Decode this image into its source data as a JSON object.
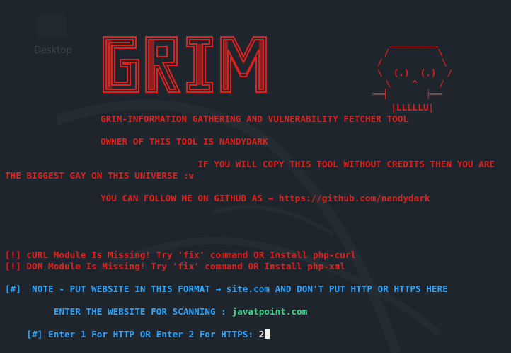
{
  "desktop": {
    "label": "Desktop"
  },
  "banner": {
    "logo_text": "GRIM",
    "skull": [
      " _________",
      " /         \\",
      "/           \\",
      "\\  (.)  (.)  /",
      " \\    ^    /",
      " ══╡       ╞══",
      "    |LLLLLU|"
    ]
  },
  "lines": {
    "title": "GRIM-INFORMATION GATHERING AND VULNERABILITY FETCHER TOOL",
    "owner": "OWNER OF THIS TOOL IS NANDYDARK",
    "credits_1": "                  IF YOU WILL COPY THIS TOOL WITHOUT CREDITS THEN YOU ARE",
    "credits_2": "THE BIGGEST GAY ON THIS UNIVERSE :v",
    "follow": "YOU CAN FOLLOW ME ON GITHUB AS → https://github.com/nandydark",
    "err_curl": "[!] cURL Module Is Missing! Try 'fix' command OR Install php-curl",
    "err_dom": "[!] DOM Module Is Missing! Try 'fix' command OR Install php-xml",
    "note": "[#]  NOTE - PUT WEBSITE IN THIS FORMAT → site.com AND DON'T PUT HTTP OR HTTPS HERE",
    "enter_site_prompt": "     ENTER THE WEBSITE FOR SCANNING : ",
    "enter_site_value": "javatpoint.com",
    "protocol_prompt": "[#] Enter 1 For HTTP OR Enter 2 For HTTPS: ",
    "protocol_value": "2"
  },
  "colors": {
    "background": "#1f252c",
    "error_red": "#e0201c",
    "info_blue": "#28a3ff",
    "input_green": "#39d98a"
  }
}
